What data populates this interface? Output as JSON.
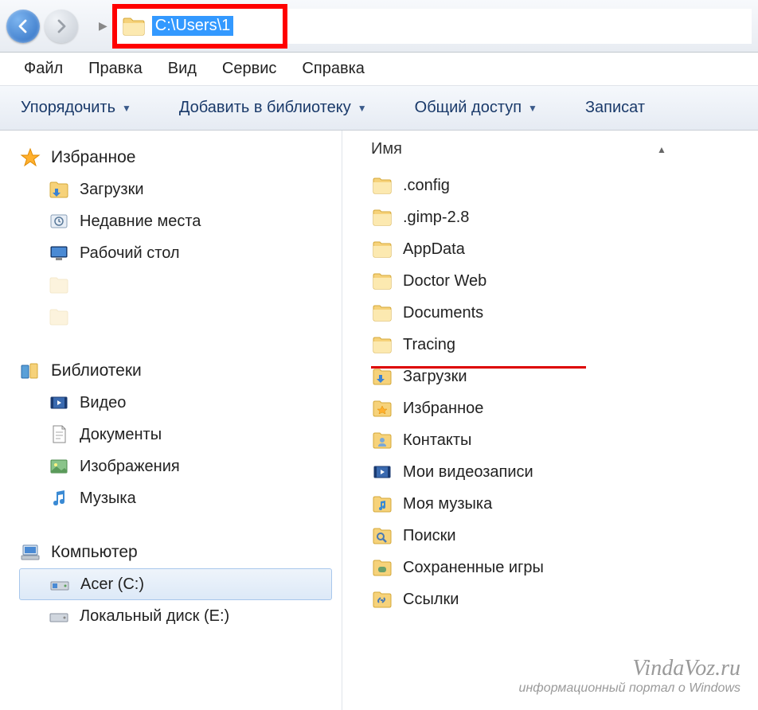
{
  "address": {
    "path": "C:\\Users\\1"
  },
  "menu": {
    "file": "Файл",
    "edit": "Правка",
    "view": "Вид",
    "service": "Сервис",
    "help": "Справка"
  },
  "toolbar": {
    "organize": "Упорядочить",
    "add_library": "Добавить в библиотеку",
    "share": "Общий доступ",
    "burn": "Записат"
  },
  "column": {
    "name": "Имя"
  },
  "sidebar": {
    "favorites": {
      "title": "Избранное",
      "downloads": "Загрузки",
      "recent": "Недавние места",
      "desktop": "Рабочий стол"
    },
    "libraries": {
      "title": "Библиотеки",
      "video": "Видео",
      "documents": "Документы",
      "pictures": "Изображения",
      "music": "Музыка"
    },
    "computer": {
      "title": "Компьютер",
      "drive_c": "Acer (C:)",
      "drive_e": "Локальный диск (E:)"
    }
  },
  "files": {
    "items": [
      ".config",
      ".gimp-2.8",
      "AppData",
      "Doctor Web",
      "Documents",
      "Tracing",
      "Загрузки",
      "Избранное",
      "Контакты",
      "Мои видеозаписи",
      "Моя музыка",
      "Поиски",
      "Сохраненные игры",
      "Ссылки"
    ]
  },
  "watermark": {
    "site": "VindaVoz.ru",
    "tagline": "информационный портал о Windows"
  }
}
